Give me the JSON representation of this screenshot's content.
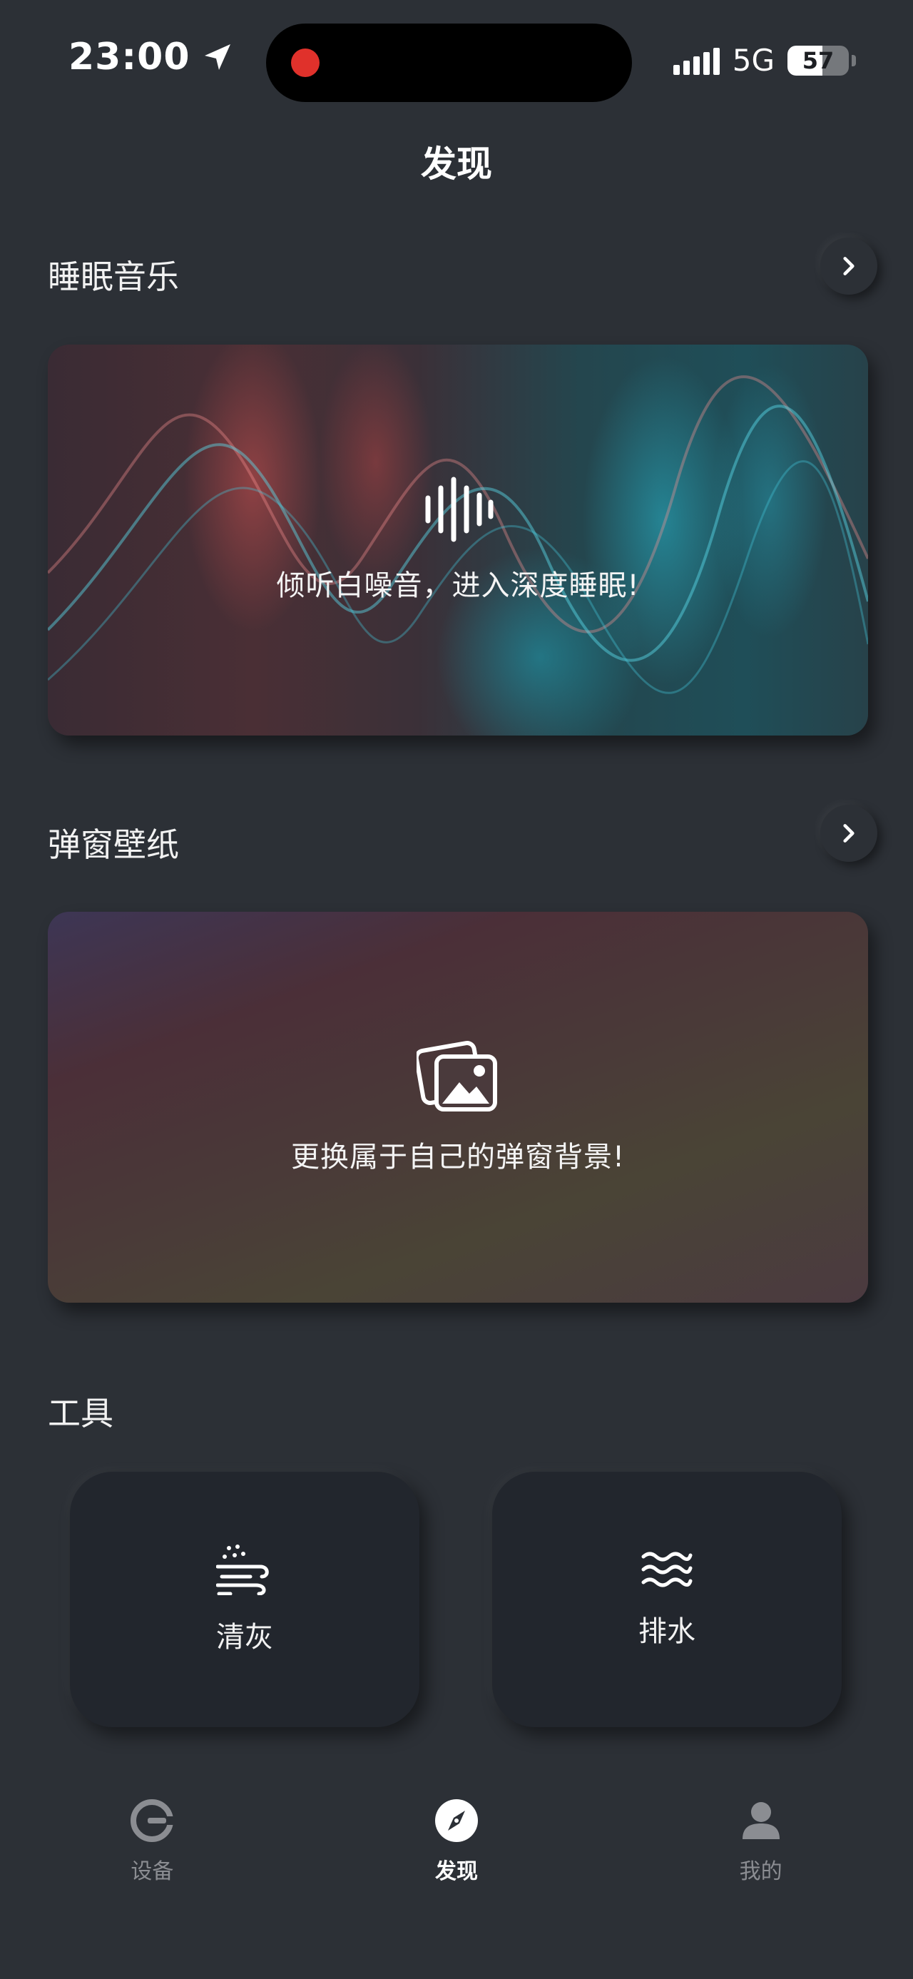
{
  "status_bar": {
    "time": "23:00",
    "network": "5G",
    "battery": "57",
    "battery_level_percent": 57,
    "icons": [
      "location-arrow-icon",
      "signal-icon",
      "battery-icon"
    ]
  },
  "page": {
    "title": "发现"
  },
  "sections": {
    "sleep_music": {
      "title": "睡眠音乐",
      "card_text": "倾听白噪音，进入深度睡眠!",
      "icon": "sound-wave-icon"
    },
    "wallpaper": {
      "title": "弹窗壁纸",
      "card_text": "更换属于自己的弹窗背景!",
      "icon": "image-gallery-icon"
    },
    "tools": {
      "title": "工具",
      "items": [
        {
          "label": "清灰",
          "icon": "dust-clean-icon"
        },
        {
          "label": "排水",
          "icon": "water-drain-icon"
        }
      ]
    }
  },
  "bottom_nav": {
    "items": [
      {
        "label": "设备",
        "icon": "device-icon",
        "active": false
      },
      {
        "label": "发现",
        "icon": "compass-icon",
        "active": true
      },
      {
        "label": "我的",
        "icon": "person-icon",
        "active": false
      }
    ]
  },
  "colors": {
    "background": "#2c3036",
    "tool_card": "#22262d",
    "inactive_nav": "#8b8d92",
    "record_dot": "#e0312b"
  }
}
